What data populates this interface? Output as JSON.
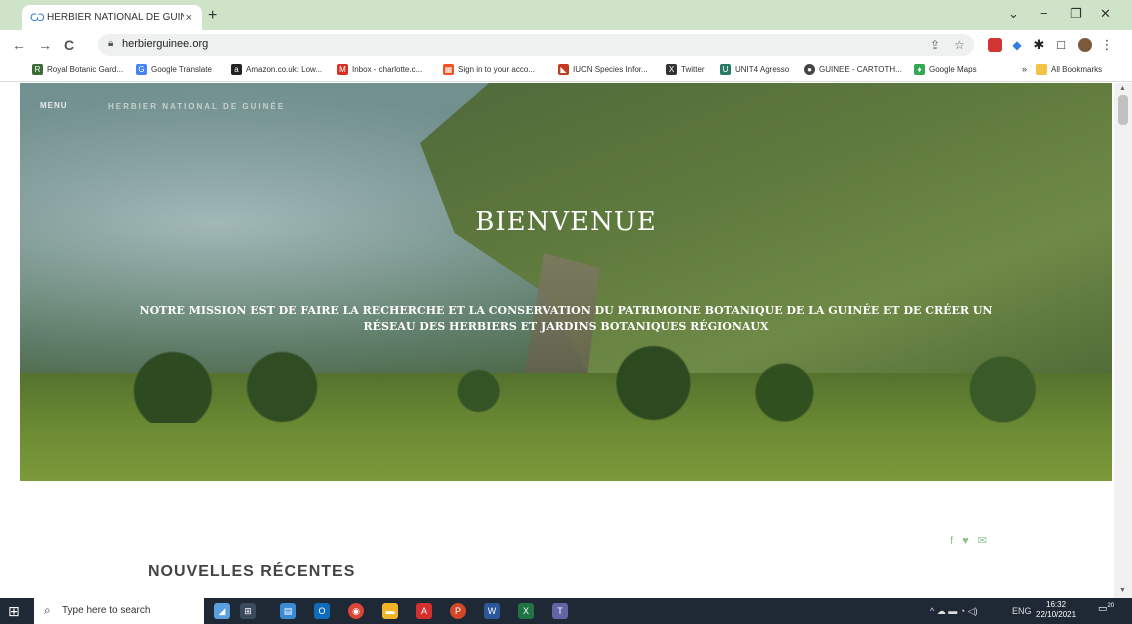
{
  "browser": {
    "tab_title": "HERBIER NATIONAL DE GUINEE",
    "tab_close": "×",
    "new_tab": "+",
    "window_controls": [
      "⌄",
      "−",
      "❐",
      "✕"
    ],
    "nav": {
      "back": "←",
      "forward": "→",
      "reload": "C"
    },
    "url": "herbierguinee.org",
    "extensions": [
      {
        "name": "share-icon",
        "glyph": "⇪",
        "color": "#888888"
      },
      {
        "name": "star-icon",
        "glyph": "☆",
        "color": "#888888"
      },
      {
        "name": "extension-red-icon",
        "glyph": "■",
        "color": "#d23333"
      },
      {
        "name": "extension-blue-icon",
        "glyph": "◆",
        "color": "#2f7de0"
      },
      {
        "name": "puzzle-icon",
        "glyph": "✱",
        "color": "#333333"
      },
      {
        "name": "sidepanel-icon",
        "glyph": "□",
        "color": "#333333"
      },
      {
        "name": "profile-avatar",
        "glyph": "●",
        "color": "#7a5a3a"
      },
      {
        "name": "kebab-menu-icon",
        "glyph": "⋮",
        "color": "#333333"
      }
    ]
  },
  "bookmarks": [
    {
      "label": "Royal Botanic Gard...",
      "icon": "R",
      "color": "#3a6b35"
    },
    {
      "label": "Google Translate",
      "icon": "G",
      "color": "#4285f4"
    },
    {
      "label": "Amazon.co.uk: Low...",
      "icon": "a",
      "color": "#222222"
    },
    {
      "label": "Inbox - charlotte.c...",
      "icon": "M",
      "color": "#d93025"
    },
    {
      "label": "Sign in to your acco...",
      "icon": "▦",
      "color": "#f25022"
    },
    {
      "label": "IUCN Species Infor...",
      "icon": "◣",
      "color": "#c23b22"
    },
    {
      "label": "Twitter",
      "icon": "X",
      "color": "#333333"
    },
    {
      "label": "UNIT4 Agresso",
      "icon": "U",
      "color": "#2a7a6b"
    },
    {
      "label": "GUINEE - CARTOTH...",
      "icon": "●",
      "color": "#444444"
    },
    {
      "label": "Google Maps",
      "icon": "♦",
      "color": "#34a853"
    }
  ],
  "bookmarks_overflow": "»",
  "bookmarks_all": "All Bookmarks",
  "site": {
    "menu": "MENU",
    "brand": "HERBIER NATIONAL DE GUINÉE",
    "welcome": "BIENVENUE",
    "mission_line1": "NOTRE MISSION EST DE FAIRE LA RECHERCHE ET LA CONSERVATION DU PATRIMOINE BOTANIQUE DE LA GUINÉE ET DE CRÉER UN",
    "mission_line2": "RÉSEAU DES HERBIERS ET JARDINS BOTANIQUES RÉGIONAUX",
    "social": "f ♥ ✉",
    "section_title": "NOUVELLES RÉCENTES"
  },
  "taskbar": {
    "search_placeholder": "Type here to search",
    "apps": [
      {
        "name": "widgets-icon",
        "color": "#5aa0e0",
        "glyph": "◢"
      },
      {
        "name": "task-view-icon",
        "color": "#3b4a5c",
        "glyph": "⊞"
      },
      {
        "name": "file-explorer-icon",
        "color": "#3a8ad6",
        "glyph": "▤"
      },
      {
        "name": "outlook-icon",
        "color": "#0f6cbd",
        "glyph": "O"
      },
      {
        "name": "chrome-icon",
        "color": "#db4437",
        "glyph": "◉"
      },
      {
        "name": "folder-icon",
        "color": "#f0b429",
        "glyph": "▬"
      },
      {
        "name": "acrobat-icon",
        "color": "#d32f2f",
        "glyph": "A"
      },
      {
        "name": "powerpoint-icon",
        "color": "#d24726",
        "glyph": "P"
      },
      {
        "name": "word-icon",
        "color": "#2b579a",
        "glyph": "W"
      },
      {
        "name": "excel-icon",
        "color": "#217346",
        "glyph": "X"
      },
      {
        "name": "teams-icon",
        "color": "#6264a7",
        "glyph": "T"
      }
    ],
    "tray": "^  ☁  ▬  ◔  ◁)",
    "lang": "ENG",
    "time": "16:32",
    "date": "22/10/2021",
    "notifications": "20"
  }
}
